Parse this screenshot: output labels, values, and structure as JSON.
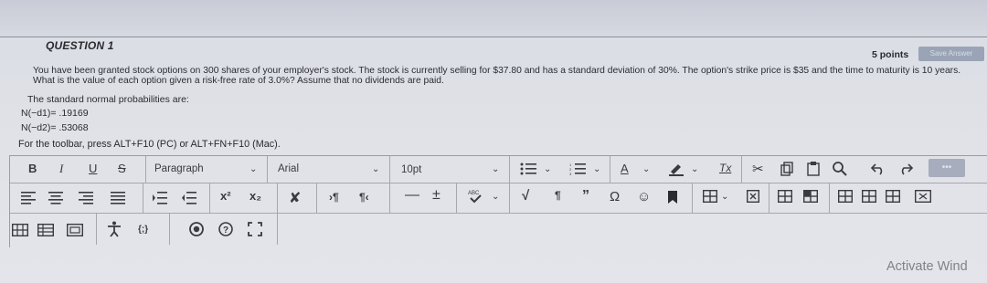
{
  "question": {
    "title": "QUESTION 1",
    "points": "5 points",
    "save_button": "Save Answer",
    "text": "You have been granted stock options on 300 shares of your employer's stock. The stock is currently selling for $37.80 and has a standard deviation of 30%. The option's strike price is $35 and the time to maturity is 10 years. What is the value of each option given a risk-free rate of 3.0%? Assume that no dividends are paid.",
    "standard_normal_label": "The standard normal probabilities are:",
    "nd1": "N(−d1)= .19169",
    "nd2": "N(−d2)= .53068"
  },
  "editor_hint": "For the toolbar, press ALT+F10 (PC) or ALT+FN+F10 (Mac).",
  "toolbar": {
    "bold": "B",
    "italic": "I",
    "underline": "U",
    "strikethrough": "S",
    "paragraph_select": "Paragraph",
    "font_select": "Arial",
    "size_select": "10pt",
    "font_color_letter": "A",
    "clear_format": "Tx",
    "superscript": "x²",
    "subscript": "x₂",
    "pilcrow": "¶",
    "quote": "”",
    "omega": "Ω",
    "math_block": "{;}",
    "more": "•••"
  },
  "overlay": {
    "activate_windows": "Activate Wind"
  },
  "colors": {
    "background": "#dfe1e7",
    "text": "#2a2a2e",
    "separator": "#a5a7ae"
  }
}
